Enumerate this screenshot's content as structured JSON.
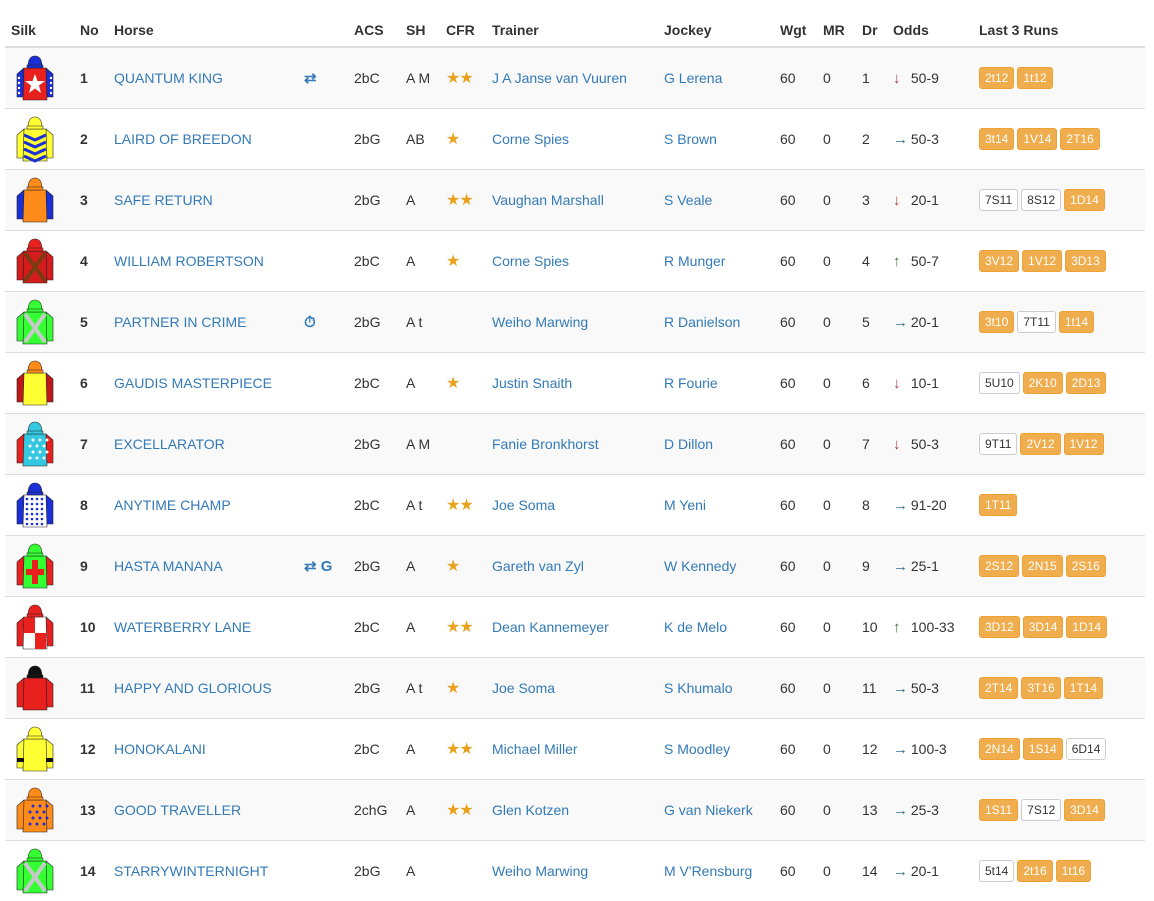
{
  "headers": [
    "Silk",
    "No",
    "Horse",
    "",
    "ACS",
    "SH",
    "CFR",
    "Trainer",
    "Jockey",
    "Wgt",
    "MR",
    "Dr",
    "Odds",
    "Last 3 Runs"
  ],
  "colors": {
    "link": "#337ab7",
    "star": "#e9a21d",
    "run_highlight": "#f0ad4e",
    "odds_down": "#a94442",
    "odds_right": "#31708f",
    "odds_up": "#3c763d"
  },
  "rows": [
    {
      "no": "1",
      "horse": "QUANTUM KING",
      "flags": "⇄",
      "acs": "2bC",
      "sh": "A M",
      "cfr": "★★",
      "trainer": "J A Janse van Vuuren",
      "jockey": "G Lerena",
      "wgt": "60",
      "mr": "0",
      "dr": "1",
      "odds_dir": "down",
      "odds": "50-9",
      "runs": [
        {
          "t": "2t12",
          "hl": true
        },
        {
          "t": "1t12",
          "hl": true
        }
      ],
      "silk": {
        "cap": "#1a2fd6",
        "body": "#e8201e",
        "sleeve": "#1a2fd6",
        "pattern": "bigstar",
        "pcolor": "#ffffff"
      }
    },
    {
      "no": "2",
      "horse": "LAIRD OF BREEDON",
      "flags": "",
      "acs": "2bG",
      "sh": "AB",
      "cfr": "★",
      "trainer": "Corne Spies",
      "jockey": "S Brown",
      "wgt": "60",
      "mr": "0",
      "dr": "2",
      "odds_dir": "right",
      "odds": "50-3",
      "runs": [
        {
          "t": "3t14",
          "hl": true
        },
        {
          "t": "1V14",
          "hl": true
        },
        {
          "t": "2T16",
          "hl": true
        }
      ],
      "silk": {
        "cap": "#ffff33",
        "body": "#ffff33",
        "sleeve": "#ffff33",
        "pattern": "chevrons",
        "pcolor": "#1a2fd6"
      }
    },
    {
      "no": "3",
      "horse": "SAFE RETURN",
      "flags": "",
      "acs": "2bG",
      "sh": "A",
      "cfr": "★★",
      "trainer": "Vaughan Marshall",
      "jockey": "S Veale",
      "wgt": "60",
      "mr": "0",
      "dr": "3",
      "odds_dir": "down",
      "odds": "20-1",
      "runs": [
        {
          "t": "7S11",
          "hl": false
        },
        {
          "t": "8S12",
          "hl": false
        },
        {
          "t": "1D14",
          "hl": true
        }
      ],
      "silk": {
        "cap": "#ff8c1a",
        "body": "#ff8c1a",
        "sleeve": "#1a2fd6",
        "pattern": "none",
        "pcolor": "#ff8c1a"
      }
    },
    {
      "no": "4",
      "horse": "WILLIAM ROBERTSON",
      "flags": "",
      "acs": "2bC",
      "sh": "A",
      "cfr": "★",
      "trainer": "Corne Spies",
      "jockey": "R Munger",
      "wgt": "60",
      "mr": "0",
      "dr": "4",
      "odds_dir": "up",
      "odds": "50-7",
      "runs": [
        {
          "t": "3V12",
          "hl": true
        },
        {
          "t": "1V12",
          "hl": true
        },
        {
          "t": "3D13",
          "hl": true
        }
      ],
      "silk": {
        "cap": "#e8201e",
        "body": "#d41c1c",
        "sleeve": "#d41c1c",
        "pattern": "cross",
        "pcolor": "#7a3a12"
      }
    },
    {
      "no": "5",
      "horse": "PARTNER IN CRIME",
      "flags": "⏱",
      "acs": "2bG",
      "sh": "A t",
      "cfr": "",
      "trainer": "Weiho Marwing",
      "jockey": "R Danielson",
      "wgt": "60",
      "mr": "0",
      "dr": "5",
      "odds_dir": "right",
      "odds": "20-1",
      "runs": [
        {
          "t": "3t10",
          "hl": true
        },
        {
          "t": "7T11",
          "hl": false
        },
        {
          "t": "1t14",
          "hl": true
        }
      ],
      "silk": {
        "cap": "#33ff33",
        "body": "#33ff33",
        "sleeve": "#33ff33",
        "pattern": "cross",
        "pcolor": "#c8c8c8"
      }
    },
    {
      "no": "6",
      "horse": "GAUDIS MASTERPIECE",
      "flags": "",
      "acs": "2bC",
      "sh": "A",
      "cfr": "★",
      "trainer": "Justin Snaith",
      "jockey": "R Fourie",
      "wgt": "60",
      "mr": "0",
      "dr": "6",
      "odds_dir": "down",
      "odds": "10-1",
      "runs": [
        {
          "t": "5U10",
          "hl": false
        },
        {
          "t": "2K10",
          "hl": true
        },
        {
          "t": "2D13",
          "hl": true
        }
      ],
      "silk": {
        "cap": "#ff8c1a",
        "body": "#ffff33",
        "sleeve": "#c01818",
        "pattern": "none",
        "pcolor": "#ffff33"
      }
    },
    {
      "no": "7",
      "horse": "EXCELLARATOR",
      "flags": "",
      "acs": "2bG",
      "sh": "A M",
      "cfr": "",
      "trainer": "Fanie Bronkhorst",
      "jockey": "D Dillon",
      "wgt": "60",
      "mr": "0",
      "dr": "7",
      "odds_dir": "down",
      "odds": "50-3",
      "runs": [
        {
          "t": "9T11",
          "hl": false
        },
        {
          "t": "2V12",
          "hl": true
        },
        {
          "t": "1V12",
          "hl": true
        }
      ],
      "silk": {
        "cap": "#33c8e0",
        "body": "#33c8e0",
        "sleeve": "#e8201e",
        "pattern": "stars",
        "pcolor": "#ffffff"
      }
    },
    {
      "no": "8",
      "horse": "ANYTIME CHAMP",
      "flags": "",
      "acs": "2bC",
      "sh": "A t",
      "cfr": "★★",
      "trainer": "Joe Soma",
      "jockey": "M Yeni",
      "wgt": "60",
      "mr": "0",
      "dr": "8",
      "odds_dir": "right",
      "odds": "91-20",
      "runs": [
        {
          "t": "1T11",
          "hl": true
        }
      ],
      "silk": {
        "cap": "#1a2fd6",
        "body": "#ffffff",
        "sleeve": "#1a2fd6",
        "pattern": "dots",
        "pcolor": "#1a2fd6"
      }
    },
    {
      "no": "9",
      "horse": "HASTA MANANA",
      "flags": "⇄ G",
      "acs": "2bG",
      "sh": "A",
      "cfr": "★",
      "trainer": "Gareth van Zyl",
      "jockey": "W Kennedy",
      "wgt": "60",
      "mr": "0",
      "dr": "9",
      "odds_dir": "right",
      "odds": "25-1",
      "runs": [
        {
          "t": "2S12",
          "hl": true
        },
        {
          "t": "2N15",
          "hl": true
        },
        {
          "t": "2S16",
          "hl": true
        }
      ],
      "silk": {
        "cap": "#33ff33",
        "body": "#33ff33",
        "sleeve": "#e8201e",
        "pattern": "maltese",
        "pcolor": "#e8201e"
      }
    },
    {
      "no": "10",
      "horse": "WATERBERRY LANE",
      "flags": "",
      "acs": "2bC",
      "sh": "A",
      "cfr": "★★",
      "trainer": "Dean Kannemeyer",
      "jockey": "K de Melo",
      "wgt": "60",
      "mr": "0",
      "dr": "10",
      "odds_dir": "up",
      "odds": "100-33",
      "runs": [
        {
          "t": "3D12",
          "hl": true
        },
        {
          "t": "3D14",
          "hl": true
        },
        {
          "t": "1D14",
          "hl": true
        }
      ],
      "silk": {
        "cap": "#e8201e",
        "body": "#ffffff",
        "sleeve": "#e8201e",
        "pattern": "check",
        "pcolor": "#e8201e"
      }
    },
    {
      "no": "11",
      "horse": "HAPPY AND GLORIOUS",
      "flags": "",
      "acs": "2bG",
      "sh": "A t",
      "cfr": "★",
      "trainer": "Joe Soma",
      "jockey": "S Khumalo",
      "wgt": "60",
      "mr": "0",
      "dr": "11",
      "odds_dir": "right",
      "odds": "50-3",
      "runs": [
        {
          "t": "2T14",
          "hl": true
        },
        {
          "t": "3T16",
          "hl": true
        },
        {
          "t": "1T14",
          "hl": true
        }
      ],
      "silk": {
        "cap": "#111111",
        "body": "#e8201e",
        "sleeve": "#e8201e",
        "pattern": "none",
        "pcolor": "#e8201e"
      }
    },
    {
      "no": "12",
      "horse": "HONOKALANI",
      "flags": "",
      "acs": "2bC",
      "sh": "A",
      "cfr": "★★",
      "trainer": "Michael Miller",
      "jockey": "S Moodley",
      "wgt": "60",
      "mr": "0",
      "dr": "12",
      "odds_dir": "right",
      "odds": "100-3",
      "runs": [
        {
          "t": "2N14",
          "hl": true
        },
        {
          "t": "1S14",
          "hl": true
        },
        {
          "t": "6D14",
          "hl": false
        }
      ],
      "silk": {
        "cap": "#ffff33",
        "body": "#ffff33",
        "sleeve": "#ffff33",
        "pattern": "armbands",
        "pcolor": "#111111"
      }
    },
    {
      "no": "13",
      "horse": "GOOD TRAVELLER",
      "flags": "",
      "acs": "2chG",
      "sh": "A",
      "cfr": "★★",
      "trainer": "Glen Kotzen",
      "jockey": "G van Niekerk",
      "wgt": "60",
      "mr": "0",
      "dr": "13",
      "odds_dir": "right",
      "odds": "25-3",
      "runs": [
        {
          "t": "1S11",
          "hl": true
        },
        {
          "t": "7S12",
          "hl": false
        },
        {
          "t": "3D14",
          "hl": true
        }
      ],
      "silk": {
        "cap": "#ff8c1a",
        "body": "#ff8c1a",
        "sleeve": "#ff8c1a",
        "pattern": "stars",
        "pcolor": "#1a2fd6"
      }
    },
    {
      "no": "14",
      "horse": "STARRYWINTERNIGHT",
      "flags": "",
      "acs": "2bG",
      "sh": "A",
      "cfr": "",
      "trainer": "Weiho Marwing",
      "jockey": "M V'Rensburg",
      "wgt": "60",
      "mr": "0",
      "dr": "14",
      "odds_dir": "right",
      "odds": "20-1",
      "runs": [
        {
          "t": "5t14",
          "hl": false
        },
        {
          "t": "2t16",
          "hl": true
        },
        {
          "t": "1t16",
          "hl": true
        }
      ],
      "silk": {
        "cap": "#33ff33",
        "body": "#33ff33",
        "sleeve": "#33ff33",
        "pattern": "cross",
        "pcolor": "#c8c8c8"
      }
    }
  ]
}
